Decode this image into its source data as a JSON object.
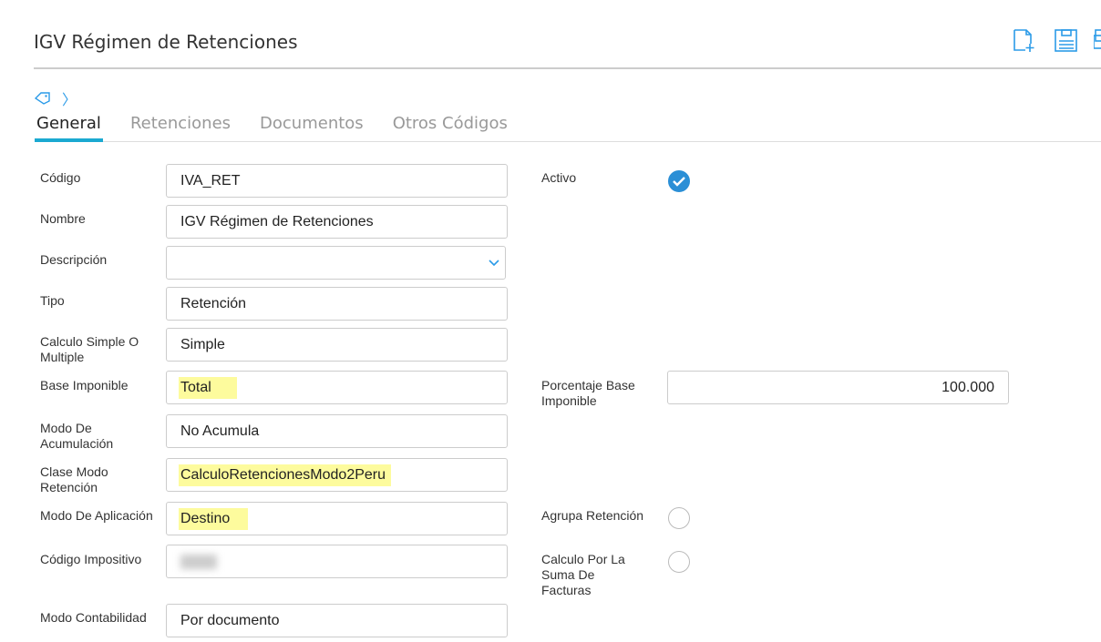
{
  "header": {
    "title": "IGV Régimen de Retenciones",
    "tools": [
      {
        "icon": "new-document-icon"
      },
      {
        "icon": "save-icon"
      },
      {
        "icon": "copy-icon"
      }
    ]
  },
  "breadcrumb": {
    "icon": "tag-icon",
    "separator": "〉"
  },
  "tabs": [
    {
      "label": "General",
      "active": true
    },
    {
      "label": "Retenciones"
    },
    {
      "label": "Documentos"
    },
    {
      "label": "Otros Códigos"
    }
  ],
  "accent": "#1ba9d1",
  "form": {
    "codigo": {
      "label": "Código",
      "value": "IVA_RET"
    },
    "nombre": {
      "label": "Nombre",
      "value": "IGV Régimen de Retenciones"
    },
    "descripcion": {
      "label": "Descripción",
      "value": ""
    },
    "tipo": {
      "label": "Tipo",
      "value": "Retención"
    },
    "calculo": {
      "label": "Calculo Simple O Multiple",
      "value": "Simple"
    },
    "base": {
      "label": "Base Imponible",
      "value": "Total",
      "highlighted": true
    },
    "modo_acum": {
      "label": "Modo De Acumulación",
      "value": "No Acumula"
    },
    "clase": {
      "label": "Clase Modo Retención",
      "value": "CalculoRetencionesModo2Peru",
      "highlighted": true
    },
    "modo_aplic": {
      "label": "Modo De Aplicación",
      "value": "Destino",
      "highlighted": true
    },
    "cod_imp": {
      "label": "Código Impositivo"
    },
    "modo_cont": {
      "label": "Modo Contabilidad",
      "value": "Por documento"
    },
    "activo": {
      "label": "Activo",
      "checked": true
    },
    "porcentaje": {
      "label": "Porcentaje Base Imponible",
      "value": "100.000"
    },
    "agrupa": {
      "label": "Agrupa Retención",
      "checked": false
    },
    "suma": {
      "label": "Calculo Por La Suma De Facturas",
      "checked": false
    }
  }
}
